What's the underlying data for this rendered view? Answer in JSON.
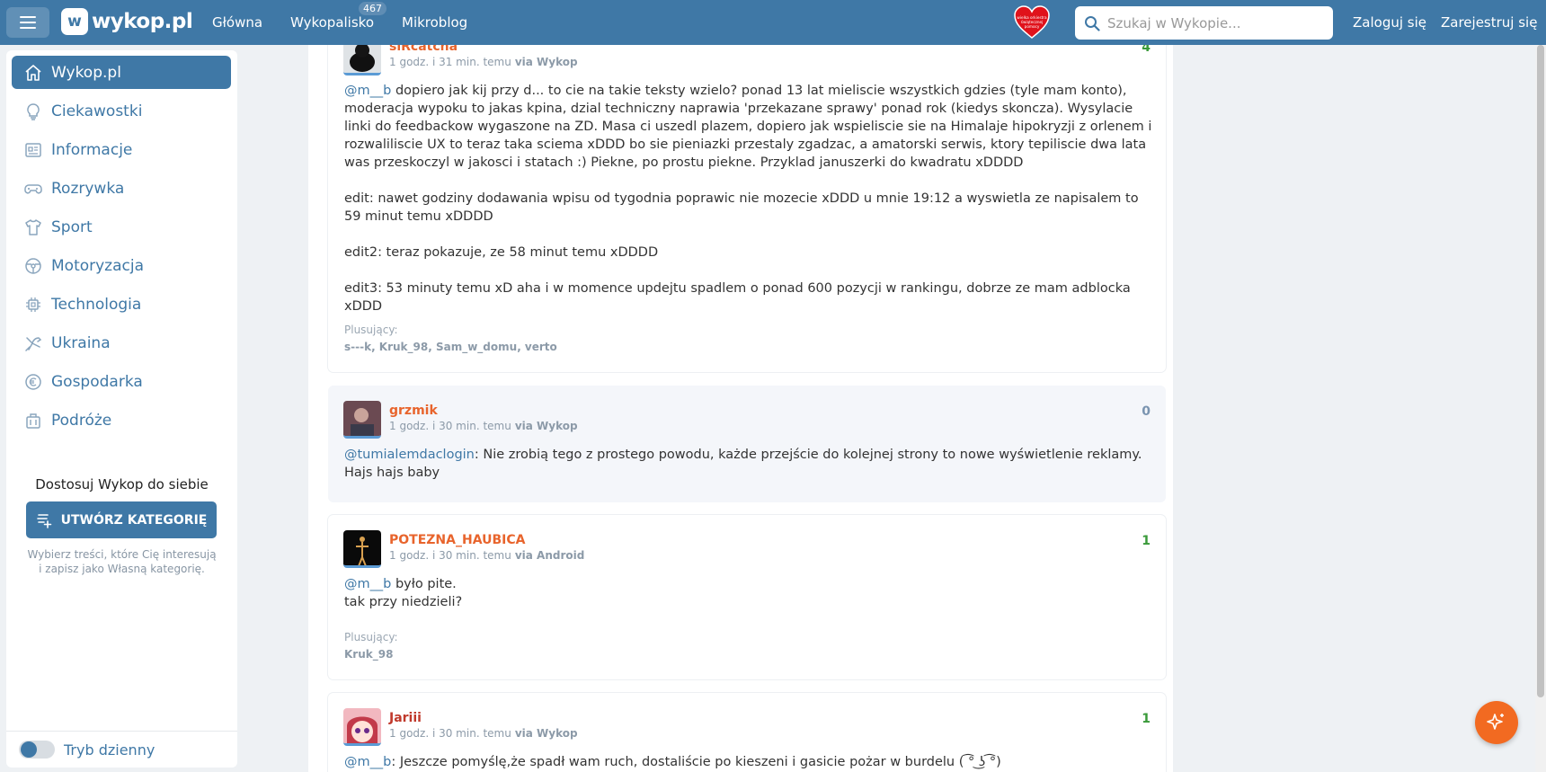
{
  "header": {
    "logo_text": "wykop.pl",
    "nav": [
      {
        "label": "Główna"
      },
      {
        "label": "Wykopalisko",
        "badge": "467"
      },
      {
        "label": "Mikroblog"
      }
    ],
    "search_placeholder": "Szukaj w Wykopie...",
    "login": "Zaloguj się",
    "register": "Zarejestruj się",
    "heart_text": "wielka orkiestra świątecznej pomocy"
  },
  "sidebar": {
    "items": [
      {
        "label": "Wykop.pl",
        "icon": "home-icon"
      },
      {
        "label": "Ciekawostki",
        "icon": "bulb-icon"
      },
      {
        "label": "Informacje",
        "icon": "news-icon"
      },
      {
        "label": "Rozrywka",
        "icon": "gamepad-icon"
      },
      {
        "label": "Sport",
        "icon": "shirt-icon"
      },
      {
        "label": "Motoryzacja",
        "icon": "steering-wheel-icon"
      },
      {
        "label": "Technologia",
        "icon": "chip-icon"
      },
      {
        "label": "Ukraina",
        "icon": "dove-icon"
      },
      {
        "label": "Gospodarka",
        "icon": "euro-icon"
      },
      {
        "label": "Podróże",
        "icon": "suitcase-icon"
      }
    ],
    "customize_title": "Dostosuj Wykop do siebie",
    "create_button": "UTWÓRZ KATEGORIĘ",
    "customize_desc": "Wybierz treści, które Cię interesują i zapisz jako Własną kategorię.",
    "day_mode": "Tryb dzienny"
  },
  "comments": [
    {
      "author": "siRcatcha",
      "time": "1 godz. i 31 min. temu",
      "via": "via Wykop",
      "votes": "4",
      "mention": "@m__b",
      "paragraphs": [
        " dopiero jak kij przy d... to cie na takie teksty wzielo? ponad 13 lat mieliscie wszystkich gdzies (tyle mam konto), moderacja wypoku to jakas kpina, dzial techniczny naprawia 'przekazane sprawy' ponad rok (kiedys skoncza). Wysylacie linki do feedbackow wygaszone na ZD. Masa ci uszedl plazem, dopiero jak wspieliscie sie na Himalaje hipokryzji z orlenem i rozwaliliscie UX to teraz taka sciema xDDD bo sie pieniazki przestaly zgadzac, a amatorski serwis, ktory tepiliscie dwa lata was przeskoczyl w jakosci i statach :) Piekne, po prostu piekne. Przyklad januszerki do kwadratu xDDDD",
        "edit: nawet godziny dodawania wpisu od tygodnia poprawic nie mozecie xDDD u mnie 19:12 a wyswietla ze napisalem to 59 minut temu xDDDD",
        "edit2: teraz pokazuje, ze 58 minut temu xDDDD",
        "edit3: 53 minuty temu xD aha i w momence updejtu spadlem o ponad 600 pozycji w rankingu, dobrze ze mam adblocka xDDD"
      ],
      "plus_label": "Plusujący:",
      "plus_names": "s---k, Kruk_98, Sam_w_domu, verto"
    },
    {
      "author": "grzmik",
      "time": "1 godz. i 30 min. temu",
      "via": "via Wykop",
      "votes": "0",
      "mention": "@tumialemdaclogin",
      "text": ": Nie zrobią tego z prostego powodu, każde przejście do kolejnej strony to nowe wyświetlenie reklamy. Hajs hajs baby"
    },
    {
      "author": "POTEZNA_HAUBICA",
      "time": "1 godz. i 30 min. temu",
      "via": "via Android",
      "votes": "1",
      "mention": "@m__b",
      "line1": " było pite.",
      "line2": "tak przy niedzieli?",
      "plus_label": "Plusujący:",
      "plus_names": "Kruk_98"
    },
    {
      "author": "Jariii",
      "time": "1 godz. i 30 min. temu",
      "via": "via Wykop",
      "votes": "1",
      "mention": "@m__b",
      "text": ": Jeszcze pomyślę,że spadł wam ruch, dostaliście po kieszeni i gasicie pożar w burdelu ( ͡° ͜ʖ ͡°)"
    }
  ],
  "colors": {
    "brand": "#3f78a6",
    "author_orange": "#e8642c",
    "author_red": "#c0392b",
    "vote_green": "#3a9a3a",
    "vote_neutral": "#7a94b0",
    "fab": "#f26a21"
  }
}
